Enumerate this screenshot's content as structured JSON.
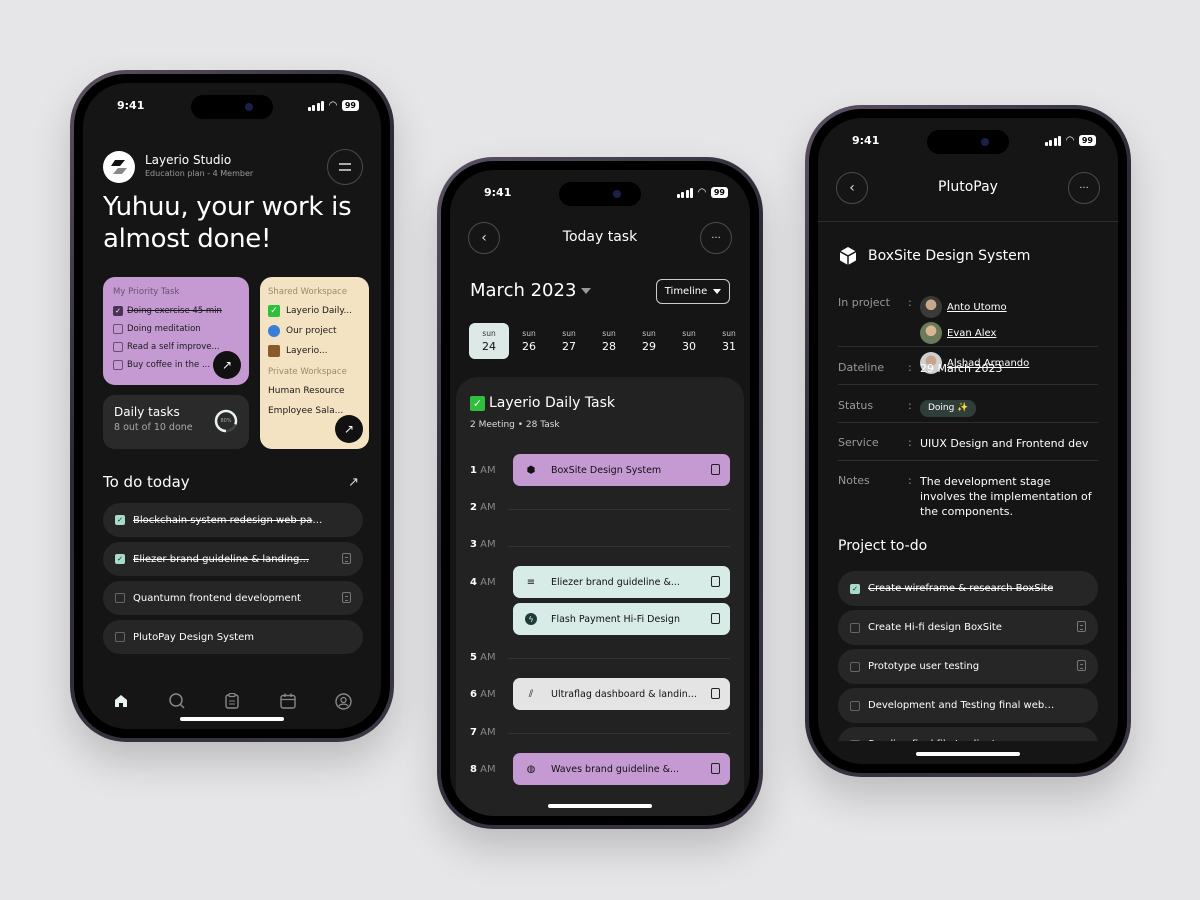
{
  "status_bar": {
    "time": "9:41",
    "battery": "99"
  },
  "phone1": {
    "workspace": {
      "name": "Layerio Studio",
      "plan": "Education plan - 4 Member"
    },
    "headline": "Yuhuu, your work is almost done!",
    "priority_card": {
      "label": "My Priority Task",
      "items": [
        {
          "text": "Doing exercise 45 min",
          "done": true
        },
        {
          "text": "Doing meditation",
          "done": false
        },
        {
          "text": "Read a self improve...",
          "done": false
        },
        {
          "text": "Buy coffee in the ...",
          "done": false
        }
      ]
    },
    "shared_card": {
      "label": "Shared Workspace",
      "items": [
        {
          "icon": "check-emoji",
          "text": "Layerio Daily..."
        },
        {
          "icon": "globe-emoji",
          "text": "Our project"
        },
        {
          "icon": "briefcase-emoji",
          "text": "Layerio..."
        }
      ],
      "private_label": "Private Workspace",
      "private_items": [
        "Human Resource",
        "Employee Sala..."
      ]
    },
    "daily_card": {
      "title": "Daily tasks",
      "subtitle": "8 out of 10 done",
      "progress": 80,
      "progress_label": "80%"
    },
    "todo": {
      "title": "To do today",
      "items": [
        {
          "text": "Blockchain system redesign web page",
          "done": true,
          "doc": false
        },
        {
          "text": "Eliezer brand guideline & landing...",
          "done": true,
          "doc": true
        },
        {
          "text": "Quantumn frontend development",
          "done": false,
          "doc": true
        },
        {
          "text": "PlutoPay Design System",
          "done": false,
          "doc": false
        }
      ]
    },
    "nav": [
      "home",
      "search",
      "tasks",
      "calendar",
      "profile"
    ]
  },
  "phone2": {
    "title": "Today task",
    "month": "March 2023",
    "view": "Timeline",
    "days": [
      {
        "name": "sun",
        "date": "24",
        "selected": true
      },
      {
        "name": "sun",
        "date": "26"
      },
      {
        "name": "sun",
        "date": "27"
      },
      {
        "name": "sun",
        "date": "28"
      },
      {
        "name": "sun",
        "date": "29"
      },
      {
        "name": "sun",
        "date": "30"
      },
      {
        "name": "sun",
        "date": "31"
      }
    ],
    "panel": {
      "title": "Layerio Daily Task",
      "subtitle": "2 Meeting • 28 Task"
    },
    "hours": [
      "1",
      "2",
      "3",
      "4",
      "5",
      "6",
      "7",
      "8"
    ],
    "hour_suffix": "AM",
    "events": [
      {
        "hour": "1",
        "title": "BoxSite Design System",
        "color": "#c59ad2"
      },
      {
        "hour": "4",
        "title": "Eliezer brand guideline &...",
        "color": "#d8ece7"
      },
      {
        "hour": "4",
        "title": "Flash Payment Hi-Fi Design",
        "color": "#d8ece7"
      },
      {
        "hour": "6",
        "title": "Ultraflag dashboard & landin...",
        "color": "#e4e4e4"
      },
      {
        "hour": "8",
        "title": "Waves brand guideline &...",
        "color": "#c59ad2"
      }
    ]
  },
  "phone3": {
    "title": "PlutoPay",
    "project": "BoxSite Design System",
    "fields": {
      "in_project_label": "In project",
      "members": [
        "Anto Utomo",
        "Evan Alex",
        "Alshad Armando"
      ],
      "dateline_label": "Dateline",
      "dateline": "29 March 2023",
      "status_label": "Status",
      "status": "Doing ✨",
      "service_label": "Service",
      "service": "UIUX Design and Frontend dev",
      "notes_label": "Notes",
      "notes": "The development stage involves the implementation of the components."
    },
    "todo": {
      "title": "Project to-do",
      "items": [
        {
          "text": "Create wireframe & research BoxSite",
          "done": true,
          "doc": false
        },
        {
          "text": "Create Hi-fi design BoxSite",
          "done": false,
          "doc": true
        },
        {
          "text": "Prototype user testing",
          "done": false,
          "doc": true
        },
        {
          "text": "Development and Testing final website",
          "done": false,
          "doc": false
        },
        {
          "text": "Sending final file to client",
          "done": false,
          "doc": false
        }
      ]
    }
  },
  "colors": {
    "purple": "#c59ad2",
    "cream": "#f4e3c2",
    "mint": "#a7dcc9",
    "bg": "#151515"
  }
}
